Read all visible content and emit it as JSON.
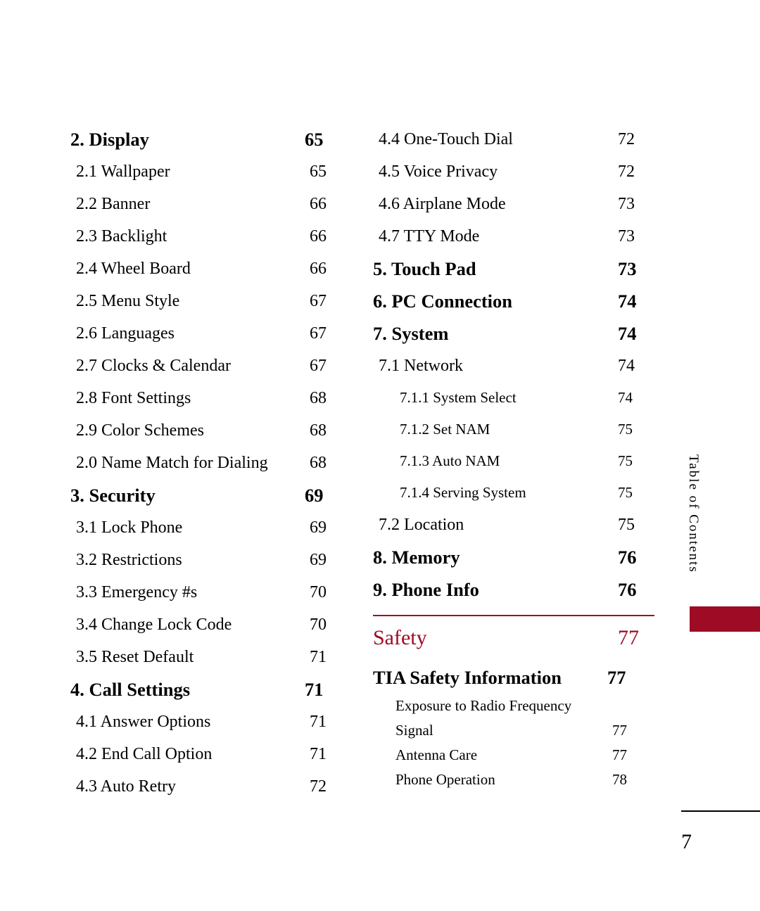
{
  "document": {
    "page_number": "7",
    "side_tab": "Table of Contents",
    "accent_color": "#9e0b24"
  },
  "left_column": [
    {
      "label": "2. Display",
      "page": "65",
      "level": 1
    },
    {
      "label": "2.1 Wallpaper",
      "page": "65",
      "level": 2
    },
    {
      "label": "2.2 Banner",
      "page": "66",
      "level": 2
    },
    {
      "label": "2.3 Backlight",
      "page": "66",
      "level": 2
    },
    {
      "label": "2.4 Wheel Board",
      "page": "66",
      "level": 2
    },
    {
      "label": "2.5 Menu Style",
      "page": "67",
      "level": 2
    },
    {
      "label": "2.6 Languages",
      "page": "67",
      "level": 2
    },
    {
      "label": "2.7 Clocks & Calendar",
      "page": "67",
      "level": 2
    },
    {
      "label": "2.8 Font Settings",
      "page": "68",
      "level": 2
    },
    {
      "label": "2.9 Color Schemes",
      "page": "68",
      "level": 2
    },
    {
      "label": "2.0  Name Match for Dialing",
      "page": "68",
      "level": 2
    },
    {
      "label": "3. Security",
      "page": "69",
      "level": 1
    },
    {
      "label": "3.1 Lock Phone",
      "page": "69",
      "level": 2
    },
    {
      "label": "3.2 Restrictions",
      "page": "69",
      "level": 2
    },
    {
      "label": "3.3 Emergency #s",
      "page": "70",
      "level": 2
    },
    {
      "label": "3.4 Change Lock Code",
      "page": "70",
      "level": 2
    },
    {
      "label": "3.5 Reset Default",
      "page": "71",
      "level": 2
    },
    {
      "label": "4. Call Settings",
      "page": "71",
      "level": 1
    },
    {
      "label": "4.1 Answer Options",
      "page": "71",
      "level": 2
    },
    {
      "label": "4.2 End Call Option",
      "page": "71",
      "level": 2
    },
    {
      "label": "4.3 Auto Retry",
      "page": "72",
      "level": 2
    }
  ],
  "right_column": [
    {
      "label": "4.4 One-Touch Dial",
      "page": "72",
      "level": 2
    },
    {
      "label": "4.5 Voice Privacy",
      "page": "72",
      "level": 2
    },
    {
      "label": "4.6 Airplane Mode",
      "page": "73",
      "level": 2
    },
    {
      "label": "4.7 TTY Mode",
      "page": "73",
      "level": 2
    },
    {
      "label": "5. Touch Pad",
      "page": "73",
      "level": 1
    },
    {
      "label": "6. PC Connection",
      "page": "74",
      "level": 1
    },
    {
      "label": "7. System",
      "page": "74",
      "level": 1
    },
    {
      "label": "7.1 Network",
      "page": "74",
      "level": 2
    },
    {
      "label": "7.1.1 System Select",
      "page": "74",
      "level": 3
    },
    {
      "label": "7.1.2 Set NAM",
      "page": "75",
      "level": 3
    },
    {
      "label": "7.1.3 Auto NAM",
      "page": "75",
      "level": 3
    },
    {
      "label": "7.1.4 Serving System",
      "page": "75",
      "level": 3
    },
    {
      "label": "7.2 Location",
      "page": "75",
      "level": 2
    },
    {
      "label": "8. Memory",
      "page": "76",
      "level": 1
    },
    {
      "label": "9. Phone Info",
      "page": "76",
      "level": 1
    }
  ],
  "safety_section": {
    "title": "Safety",
    "page": "77",
    "entries": [
      {
        "label": "TIA Safety Information",
        "page": "77",
        "level": 1
      },
      {
        "label": "Exposure to Radio Frequency",
        "page": "",
        "level": 4
      },
      {
        "label": "Signal",
        "page": "77",
        "level": 4
      },
      {
        "label": "Antenna Care",
        "page": "77",
        "level": 4
      },
      {
        "label": "Phone Operation",
        "page": "78",
        "level": 4
      }
    ]
  }
}
